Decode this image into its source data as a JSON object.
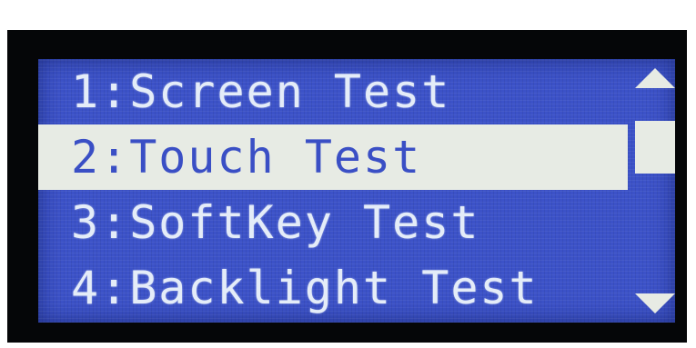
{
  "menu": {
    "items": [
      {
        "label": "1:Screen Test"
      },
      {
        "label": "2:Touch Test",
        "selected": true
      },
      {
        "label": "3:SoftKey Test"
      },
      {
        "label": "4:Backlight Test"
      }
    ]
  },
  "scrollbar": {
    "up_icon": "arrow-up-icon",
    "down_icon": "arrow-down-icon"
  },
  "colors": {
    "lcd_background": "#3c52c8",
    "text": "#e4ecf8",
    "highlight": "#e7ebe4",
    "bezel": "#050608"
  }
}
